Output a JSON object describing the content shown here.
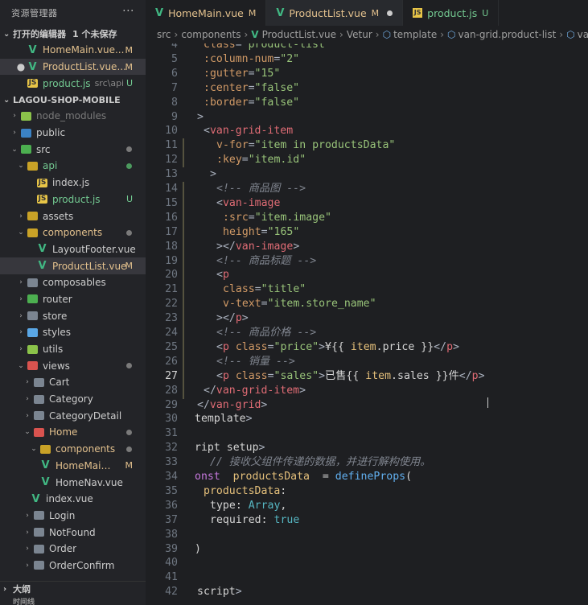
{
  "sidebar": {
    "title": "资源管理器",
    "more_label": "···",
    "open_editors": {
      "label": "打开的编辑器",
      "unsaved": "1 个未保存",
      "items": [
        {
          "name": "HomeMain.vue...",
          "path": "",
          "status": "M"
        },
        {
          "name": "ProductList.vue...",
          "path": "",
          "status": "M"
        },
        {
          "name": "product.js",
          "path": "src\\api",
          "status": "U"
        }
      ]
    },
    "project": {
      "label": "LAGOU-SHOP-MOBILE",
      "tree": [
        {
          "name": "node_modules"
        },
        {
          "name": "public"
        },
        {
          "name": "src"
        },
        {
          "name": "api"
        },
        {
          "name": "index.js"
        },
        {
          "name": "product.js",
          "status": "U"
        },
        {
          "name": "assets"
        },
        {
          "name": "components"
        },
        {
          "name": "LayoutFooter.vue"
        },
        {
          "name": "ProductList.vue",
          "status": "M"
        },
        {
          "name": "composables"
        },
        {
          "name": "router"
        },
        {
          "name": "store"
        },
        {
          "name": "styles"
        },
        {
          "name": "utils"
        },
        {
          "name": "views"
        },
        {
          "name": "Cart"
        },
        {
          "name": "Category"
        },
        {
          "name": "CategoryDetail"
        },
        {
          "name": "Home"
        },
        {
          "name": "components"
        },
        {
          "name": "HomeMain....",
          "status": "M"
        },
        {
          "name": "HomeNav.vue"
        },
        {
          "name": "index.vue"
        },
        {
          "name": "Login"
        },
        {
          "name": "NotFound"
        },
        {
          "name": "Order"
        },
        {
          "name": "OrderConfirm"
        }
      ]
    },
    "outline_label": "大纲",
    "timeline_label": "时间线"
  },
  "tabs": [
    {
      "label": "HomeMain.vue",
      "status": "M"
    },
    {
      "label": "ProductList.vue",
      "status": "M"
    },
    {
      "label": "product.js",
      "status": "U"
    }
  ],
  "breadcrumb": {
    "src": "src",
    "components": "components",
    "file": "ProductList.vue",
    "vetur": "Vetur",
    "template": "template",
    "grid": "van-grid.product-list",
    "tail": "van"
  },
  "editor": {
    "current_line": 27,
    "line_numbers": [
      "4",
      "5",
      "6",
      "7",
      "8",
      "9",
      "10",
      "11",
      "12",
      "13",
      "14",
      "15",
      "16",
      "17",
      "18",
      "19",
      "20",
      "21",
      "22",
      "23",
      "24",
      "25",
      "26",
      "27",
      "28",
      "29",
      "30",
      "31",
      "32",
      "33",
      "34",
      "35",
      "36",
      "37",
      "38",
      "39",
      "40",
      "41",
      "42"
    ],
    "lines": [
      "class=\"product-list\"",
      ":column-num=\"2\"",
      ":gutter=\"15\"",
      ":center=\"false\"",
      ":border=\"false\"",
      ">",
      "<van-grid-item",
      "v-for=\"item in productsData\"",
      ":key=\"item.id\"",
      ">",
      "<!-- 商品图 -->",
      "<van-image",
      ":src=\"item.image\"",
      "height=\"165\"",
      "></van-image>",
      "<!-- 商品标题 -->",
      "<p",
      "class=\"title\"",
      "v-text=\"item.store_name\"",
      "></p>",
      "<!-- 商品价格 -->",
      "<p class=\"price\">¥{{ item.price }}</p>",
      "<!-- 销量 -->",
      "<p class=\"sales\">已售{{ item.sales }}件</p>",
      "</van-grid-item>",
      "</van-grid>",
      "template>",
      "",
      "ript setup>",
      "// 接收父组件传递的数据，并进行解构使用。",
      "onst { productsData } = defineProps({",
      "productsData: {",
      "type: Array,",
      "required: true",
      "}",
      "})",
      "",
      "",
      "script>"
    ]
  }
}
